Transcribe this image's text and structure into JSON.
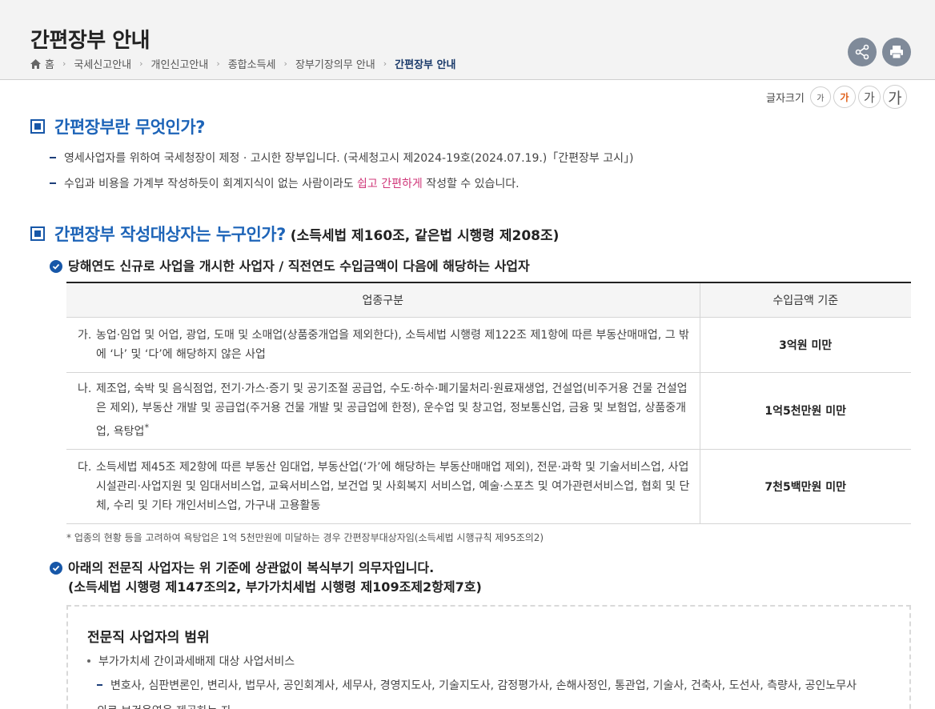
{
  "header": {
    "title": "간편장부 안내",
    "breadcrumb": [
      "홈",
      "국세신고안내",
      "개인신고안내",
      "종합소득세",
      "장부기장의무 안내"
    ],
    "breadcrumb_current": "간편장부 안내"
  },
  "font_size": {
    "label": "글자크기",
    "options": [
      "가",
      "가",
      "가",
      "가"
    ]
  },
  "section1": {
    "title": "간편장부란 무엇인가?",
    "items": [
      "영세사업자를 위하여 국세청장이 제정 · 고시한 장부입니다. (국세청고시 제2024-19호(2024.07.19.)「간편장부 고시」)"
    ],
    "item2_pre": "수입과 비용을 가계부 작성하듯이 회계지식이 없는 사람이라도 ",
    "item2_hl": "쉽고 간편하게",
    "item2_post": " 작성할 수 있습니다."
  },
  "section2": {
    "title": "간편장부 작성대상자는 누구인가?",
    "subtitle": "(소득세법 제160조, 같은법 시행령 제208조)",
    "check1": "당해연도 신규로 사업을 개시한 사업자 / 직전연도 수입금액이 다음에 해당하는 사업자",
    "table": {
      "headers": [
        "업종구분",
        "수입금액 기준"
      ],
      "rows": [
        {
          "mark": "가.",
          "text": "농업·임업 및 어업, 광업, 도매 및 소매업(상품중개업을 제외한다), 소득세법 시행령 제122조 제1항에 따른 부동산매매업, 그 밖에 ‘나’ 및 ‘다’에 해당하지 않은 사업",
          "amount": "3억원 미만"
        },
        {
          "mark": "나.",
          "text": "제조업, 숙박 및 음식점업, 전기·가스·증기 및 공기조절 공급업, 수도·하수·폐기물처리·원료재생업, 건설업(비주거용 건물 건설업은 제외), 부동산 개발 및 공급업(주거용 건물 개발 및 공급업에 한정), 운수업 및 창고업, 정보통신업, 금융 및 보험업, 상품중개업, 욕탕업",
          "sup": "*",
          "amount": "1억5천만원 미만"
        },
        {
          "mark": "다.",
          "text": "소득세법 제45조 제2항에 따른 부동산 임대업, 부동산업(‘가’에 해당하는 부동산매매업 제외), 전문·과학 및 기술서비스업, 사업시설관리·사업지원 및 임대서비스업, 교육서비스업, 보건업 및 사회복지 서비스업, 예술·스포츠 및 여가관련서비스업, 협회 및 단체, 수리 및 기타 개인서비스업, 가구내 고용활동",
          "amount": "7천5백만원 미만"
        }
      ]
    },
    "footnote": "* 업종의 현황 등을 고려하여 욕탕업은 1억 5천만원에 미달하는 경우 간편장부대상자임(소득세법 시행규칙 제95조의2)",
    "check2_line1": "아래의 전문직 사업자는 위 기준에 상관없이 복식부기 의무자입니다.",
    "check2_line2": "(소득세법 시행령 제147조의2, 부가가치세법 시행령 제109조제2항제7호)"
  },
  "pro_box": {
    "title": "전문직 사업자의 범위",
    "bullet": "부가가치세 간이과세배제 대상 사업서비스",
    "dash_item": "변호사, 심판변론인, 변리사, 법무사, 공인회계사, 세무사, 경영지도사, 기술지도사, 감정평가사, 손해사정인, 통관업, 기술사, 건축사, 도선사, 측량사, 공인노무사",
    "partial": "의료 보건용역을 제공하는 자"
  }
}
